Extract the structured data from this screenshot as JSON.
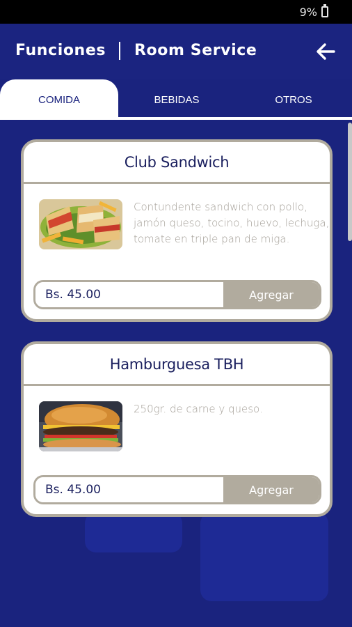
{
  "status": {
    "battery": "9%",
    "battery_icon": "battery-icon"
  },
  "header": {
    "title": "Funciones",
    "subtitle": "Room Service",
    "back_icon": "arrow-left-icon"
  },
  "tabs": [
    {
      "label": "COMIDA",
      "active": true
    },
    {
      "label": "BEBIDAS",
      "active": false
    },
    {
      "label": "OTROS",
      "active": false
    }
  ],
  "items": [
    {
      "name": "Club Sandwich",
      "description": "Contundente sandwich con pollo, jamón queso, tocino, huevo, lechuga, tomate en triple pan de miga.",
      "price": "Bs. 45.00",
      "action_label": "Agregar",
      "image": "club-sandwich-photo"
    },
    {
      "name": "Hamburguesa TBH",
      "description": "250gr. de carne y queso.",
      "price": "Bs. 45.00",
      "action_label": "Agregar",
      "image": "hamburger-photo"
    }
  ],
  "colors": {
    "primary": "#1a237e",
    "accent": "#b1ab9e",
    "text_dark": "#1a1f5e",
    "text_muted": "#a29d95"
  }
}
